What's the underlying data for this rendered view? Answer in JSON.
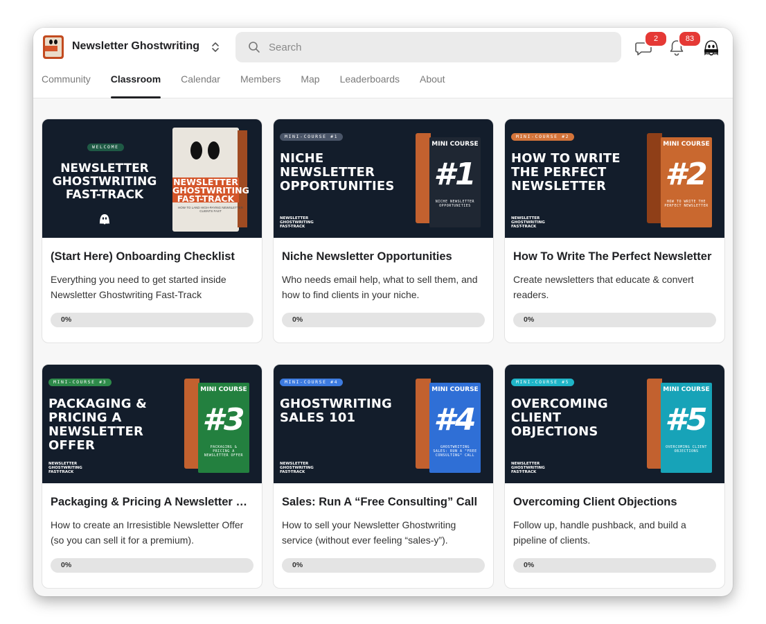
{
  "header": {
    "group_name": "Newsletter Ghostwriting",
    "search_placeholder": "Search",
    "chat_badge": "2",
    "notifications_badge": "83"
  },
  "tabs": [
    "Community",
    "Classroom",
    "Calendar",
    "Members",
    "Map",
    "Leaderboards",
    "About"
  ],
  "active_tab": "Classroom",
  "colors": {
    "accent": "#202124",
    "badge": "#e53935",
    "banner_bg": "#131d2b"
  },
  "courses": [
    {
      "banner": {
        "pill": "WELCOME",
        "title": "NEWSLETTER GHOSTWRITING FAST-TRACK",
        "box_title": "NEWSLETTER GHOSTWRITING FAST-TRACK",
        "box_caption": "HOW TO LAND HIGH-PAYING NEWSLETTER CLIENTS FAST"
      },
      "title": "(Start Here) Onboarding Checklist",
      "description": "Everything you need to get started inside Newsletter Ghostwriting Fast-Track",
      "progress": "0%",
      "progress_value": 0
    },
    {
      "banner": {
        "pill": "MINI-COURSE #1",
        "pill_color": "#4a5568",
        "title": "NICHE NEWSLETTER OPPORTUNITIES",
        "brand": "NEWSLETTER\nGHOSTWRITING\nFAST-TRACK",
        "box_tier": "MINI COURSE",
        "box_num": "#1",
        "box_sub": "NICHE NEWSLETTER OPPORTUNITIES",
        "box_color": "#1f2733",
        "box_side": "#c2612f"
      },
      "title": "Niche Newsletter Opportunities",
      "description": "Who needs email help, what to sell them, and how to find clients in your niche.",
      "progress": "0%",
      "progress_value": 0
    },
    {
      "banner": {
        "pill": "MINI-COURSE #2",
        "pill_color": "#d4743a",
        "title": "HOW TO WRITE THE PERFECT NEWSLETTER",
        "brand": "NEWSLETTER\nGHOSTWRITING\nFAST-TRACK",
        "box_tier": "MINI COURSE",
        "box_num": "#2",
        "box_sub": "HOW TO WRITE THE PERFECT NEWSLETTER",
        "box_color": "#c9682f",
        "box_side": "#8f3f18"
      },
      "title": "How To Write The Perfect Newsletter",
      "description": "Create newsletters that educate & convert readers.",
      "progress": "0%",
      "progress_value": 0
    },
    {
      "banner": {
        "pill": "MINI-COURSE #3",
        "pill_color": "#2e8b4a",
        "title": "PACKAGING & PRICING A NEWSLETTER OFFER",
        "brand": "NEWSLETTER\nGHOSTWRITING\nFAST-TRACK",
        "box_tier": "MINI COURSE",
        "box_num": "#3",
        "box_sub": "PACKAGING & PRICING A NEWSLETTER OFFER",
        "box_color": "#23803f",
        "box_side": "#c2612f"
      },
      "title": "Packaging & Pricing A Newsletter Offer",
      "description": "How to create an Irresistible Newsletter Offer (so you can sell it for a premium).",
      "progress": "0%",
      "progress_value": 0
    },
    {
      "banner": {
        "pill": "MINI-COURSE #4",
        "pill_color": "#3d7be0",
        "title": "GHOSTWRITING SALES 101",
        "brand": "NEWSLETTER\nGHOSTWRITING\nFAST-TRACK",
        "box_tier": "MINI COURSE",
        "box_num": "#4",
        "box_sub": "GHOSTWRITING SALES: RUN A \"FREE CONSULTING\" CALL",
        "box_color": "#2f6fd6",
        "box_side": "#c2612f"
      },
      "title": "Sales: Run A “Free Consulting” Call",
      "description": "How to sell your Newsletter Ghostwriting service (without ever feeling “sales-y”).",
      "progress": "0%",
      "progress_value": 0
    },
    {
      "banner": {
        "pill": "MINI-COURSE #5",
        "pill_color": "#1fb5c8",
        "title": "OVERCOMING CLIENT OBJECTIONS",
        "brand": "NEWSLETTER\nGHOSTWRITING\nFAST-TRACK",
        "box_tier": "MINI COURSE",
        "box_num": "#5",
        "box_sub": "OVERCOMING CLIENT OBJECTIONS",
        "box_color": "#17a3b8",
        "box_side": "#c2612f"
      },
      "title": "Overcoming Client Objections",
      "description": "Follow up, handle pushback, and build a pipeline of clients.",
      "progress": "0%",
      "progress_value": 0
    }
  ]
}
